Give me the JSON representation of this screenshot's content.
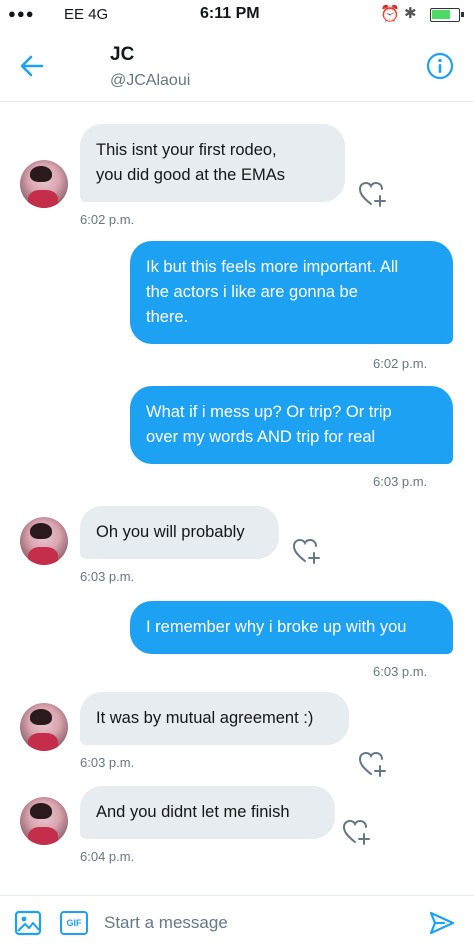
{
  "status_bar": {
    "signal": "●●●",
    "carrier": "EE  4G",
    "time": "6:11 PM"
  },
  "header": {
    "name": "JC",
    "handle": "@JCAlaoui"
  },
  "messages": [
    {
      "direction": "in",
      "lines": [
        "This isnt your first rodeo,",
        "you did good at the EMAs"
      ],
      "time": "6:02 p.m."
    },
    {
      "direction": "out",
      "lines": [
        "Ik but this feels more important. All",
        "the actors i like are gonna be",
        "there."
      ],
      "time": "6:02 p.m."
    },
    {
      "direction": "out",
      "lines": [
        "What if i mess up? Or trip? Or trip",
        "over my words AND trip for real"
      ],
      "time": "6:03 p.m."
    },
    {
      "direction": "in",
      "lines": [
        "Oh you will probably"
      ],
      "time": "6:03 p.m."
    },
    {
      "direction": "out",
      "lines": [
        "I remember why i broke up with you"
      ],
      "time": "6:03 p.m."
    },
    {
      "direction": "in",
      "lines": [
        "It was by mutual  agreement :)"
      ],
      "time": "6:03 p.m."
    },
    {
      "direction": "in",
      "lines": [
        "And you didnt let me finish"
      ],
      "time": "6:04 p.m."
    }
  ],
  "composer": {
    "placeholder": "Start a message",
    "gif_label": "GIF"
  },
  "colors": {
    "accent": "#1da1f2",
    "incoming_bubble": "#e6ecf0",
    "secondary_text": "#657786"
  }
}
